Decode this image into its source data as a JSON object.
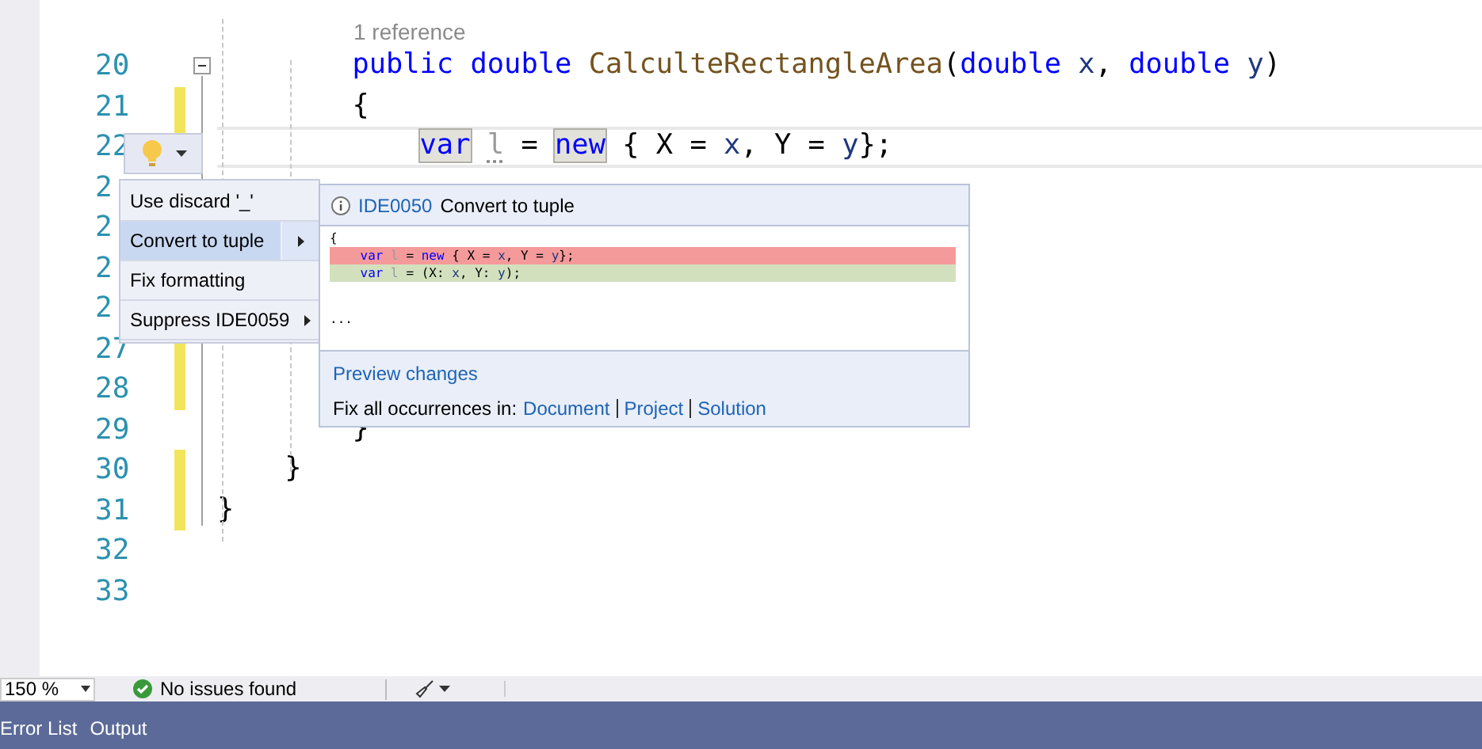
{
  "editor": {
    "codelens": "1 reference",
    "lines": [
      {
        "number": "20",
        "changed": false,
        "fold": true,
        "current": false,
        "kind": "method",
        "tokens": [
          {
            "kind": "keyword",
            "text": "public "
          },
          {
            "kind": "keyword",
            "text": "double "
          },
          {
            "kind": "method",
            "text": "CalculteRectangleArea"
          },
          {
            "kind": "plain",
            "text": "("
          },
          {
            "kind": "keyword",
            "text": "double "
          },
          {
            "kind": "param",
            "text": "x"
          },
          {
            "kind": "plain",
            "text": ", "
          },
          {
            "kind": "keyword",
            "text": "double "
          },
          {
            "kind": "param",
            "text": "y"
          },
          {
            "kind": "plain",
            "text": ")"
          }
        ]
      },
      {
        "number": "21",
        "changed": true,
        "fold": false,
        "current": false,
        "kind": "method",
        "tokens": [
          {
            "kind": "plain",
            "text": "{"
          }
        ]
      },
      {
        "number": "22",
        "changed": true,
        "fold": false,
        "current": true,
        "kind": "statement",
        "tokens": [
          {
            "kind": "highlighted-keyword",
            "text": "var "
          },
          {
            "kind": "unused",
            "text": "l"
          },
          {
            "kind": "plain",
            "text": " = "
          },
          {
            "kind": "highlighted-keyword",
            "text": "new "
          },
          {
            "kind": "plain",
            "text": "{ X = "
          },
          {
            "kind": "param",
            "text": "x"
          },
          {
            "kind": "plain",
            "text": ", Y = "
          },
          {
            "kind": "param",
            "text": "y"
          },
          {
            "kind": "plain",
            "text": "};"
          }
        ]
      },
      {
        "number": "2",
        "changed": false,
        "fold": false,
        "current": false,
        "kind": "method"
      },
      {
        "number": "2",
        "changed": false,
        "fold": false,
        "current": false,
        "kind": "method"
      },
      {
        "number": "2",
        "changed": false,
        "fold": false,
        "current": false,
        "kind": "method"
      },
      {
        "number": "2",
        "changed": false,
        "fold": false,
        "current": false,
        "kind": "method"
      },
      {
        "number": "27",
        "changed": true,
        "fold": false,
        "current": false,
        "kind": "method"
      },
      {
        "number": "28",
        "changed": true,
        "fold": false,
        "current": false,
        "kind": "method"
      },
      {
        "number": "29",
        "changed": false,
        "fold": false,
        "current": false,
        "kind": "method",
        "tokens": [
          {
            "kind": "plain",
            "text": "}"
          }
        ]
      },
      {
        "number": "30",
        "changed": true,
        "fold": false,
        "current": false,
        "kind": "class",
        "tokens": [
          {
            "kind": "plain",
            "text": "}"
          }
        ]
      },
      {
        "number": "31",
        "changed": true,
        "fold": false,
        "current": false,
        "kind": "namespace",
        "tokens": [
          {
            "kind": "plain",
            "text": "}"
          }
        ]
      },
      {
        "number": "32",
        "changed": false,
        "fold": false,
        "current": false,
        "kind": "method"
      },
      {
        "number": "33",
        "changed": false,
        "fold": false,
        "current": false,
        "kind": "method"
      }
    ]
  },
  "quick_actions": {
    "items": [
      {
        "label": "Use discard '_'",
        "selected": false,
        "submenu": false
      },
      {
        "label": "Convert to tuple",
        "selected": true,
        "submenu": true
      },
      {
        "label": "Fix formatting",
        "selected": false,
        "submenu": false
      },
      {
        "label": "Suppress IDE0059",
        "selected": false,
        "submenu": true
      }
    ]
  },
  "preview": {
    "id": "IDE0050",
    "title": "Convert to tuple",
    "lines": [
      {
        "kind": "context",
        "tokens": [
          {
            "kind": "plain",
            "text": "{"
          }
        ]
      },
      {
        "kind": "removed",
        "tokens": [
          {
            "kind": "keyword",
            "text": "var "
          },
          {
            "kind": "unused",
            "text": "l"
          },
          {
            "kind": "plain",
            "text": " = "
          },
          {
            "kind": "keyword",
            "text": "new "
          },
          {
            "kind": "plain",
            "text": "{ X = "
          },
          {
            "kind": "param",
            "text": "x"
          },
          {
            "kind": "plain",
            "text": ", Y = "
          },
          {
            "kind": "param",
            "text": "y"
          },
          {
            "kind": "plain",
            "text": "};"
          }
        ]
      },
      {
        "kind": "added",
        "tokens": [
          {
            "kind": "keyword",
            "text": "var "
          },
          {
            "kind": "unused",
            "text": "l"
          },
          {
            "kind": "plain",
            "text": " = (X: "
          },
          {
            "kind": "param",
            "text": "x"
          },
          {
            "kind": "plain",
            "text": ", Y: "
          },
          {
            "kind": "param",
            "text": "y"
          },
          {
            "kind": "plain",
            "text": ");"
          }
        ]
      },
      {
        "kind": "ellipsis",
        "tokens": [
          {
            "kind": "plain",
            "text": "..."
          }
        ]
      }
    ],
    "preview_link": "Preview changes",
    "fix_all_label": "Fix all occurrences in:",
    "scopes": [
      "Document",
      "Project",
      "Solution"
    ]
  },
  "status_bar": {
    "zoom": "150 %",
    "issues": "No issues found"
  },
  "bottom_tabs": [
    "Error List",
    "Output"
  ]
}
